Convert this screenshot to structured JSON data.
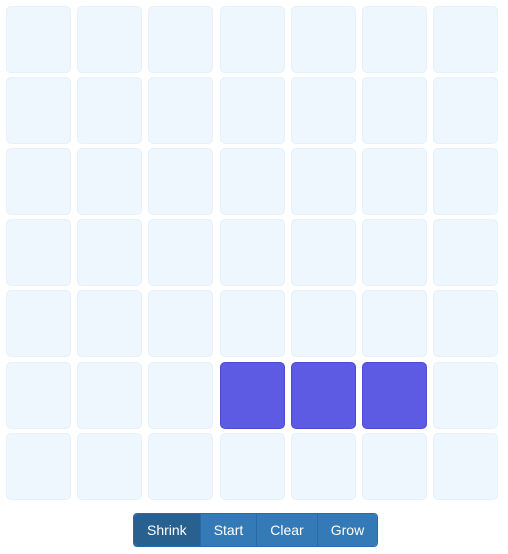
{
  "board": {
    "rows": 7,
    "cols": 7,
    "alive_cells": [
      [
        5,
        3
      ],
      [
        5,
        4
      ],
      [
        5,
        5
      ]
    ],
    "colors": {
      "dead": "#eef6fe",
      "alive": "#5d5be3"
    }
  },
  "controls": {
    "shrink_label": "Shrink",
    "start_label": "Start",
    "clear_label": "Clear",
    "grow_label": "Grow",
    "active": "shrink"
  }
}
